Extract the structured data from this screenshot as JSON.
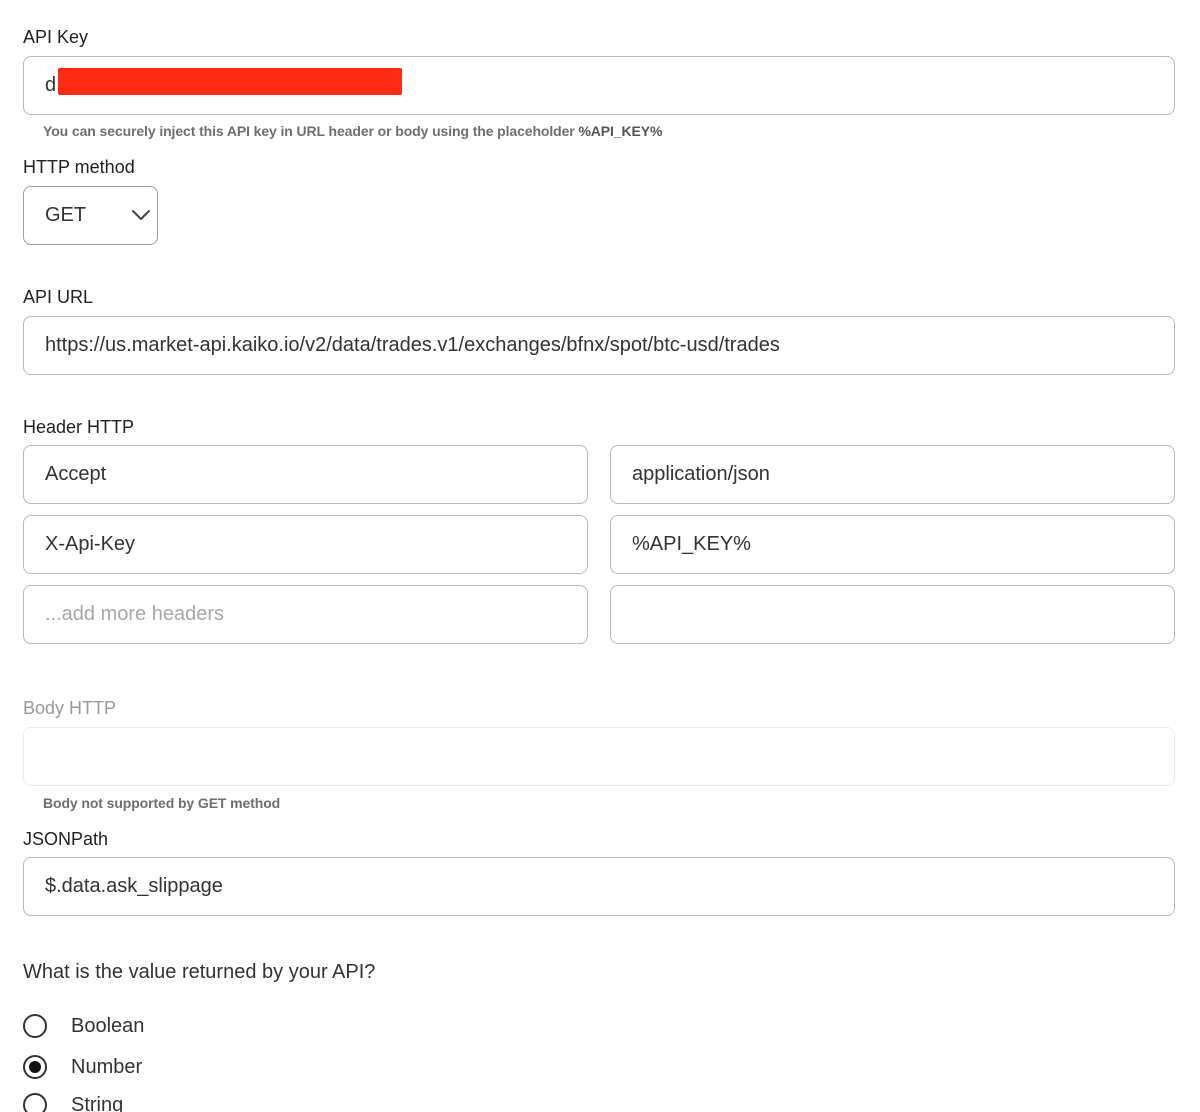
{
  "api_key": {
    "label": "API Key",
    "value_visible": "d",
    "hint_prefix": "You can securely inject this API key in URL header or body using the placeholder ",
    "hint_placeholder": "%API_KEY%"
  },
  "http_method": {
    "label": "HTTP method",
    "selected": "GET"
  },
  "api_url": {
    "label": "API URL",
    "value": "https://us.market-api.kaiko.io/v2/data/trades.v1/exchanges/bfnx/spot/btc-usd/trades"
  },
  "headers": {
    "label": "Header HTTP",
    "rows": [
      {
        "key": "Accept",
        "value": "application/json"
      },
      {
        "key": "X-Api-Key",
        "value": "%API_KEY%"
      }
    ],
    "add_placeholder": "...add more headers"
  },
  "body": {
    "label": "Body HTTP",
    "hint": "Body not supported by GET method"
  },
  "jsonpath": {
    "label": "JSONPath",
    "value": "$.data.ask_slippage"
  },
  "return_type": {
    "question": "What is the value returned by your API?",
    "options": [
      "Boolean",
      "Number",
      "String"
    ],
    "selected": "Number"
  },
  "colors": {
    "redaction": "#ff2a14",
    "border": "#b9b9b9"
  },
  "icons": {
    "select_arrow": "chevron-down-icon"
  }
}
